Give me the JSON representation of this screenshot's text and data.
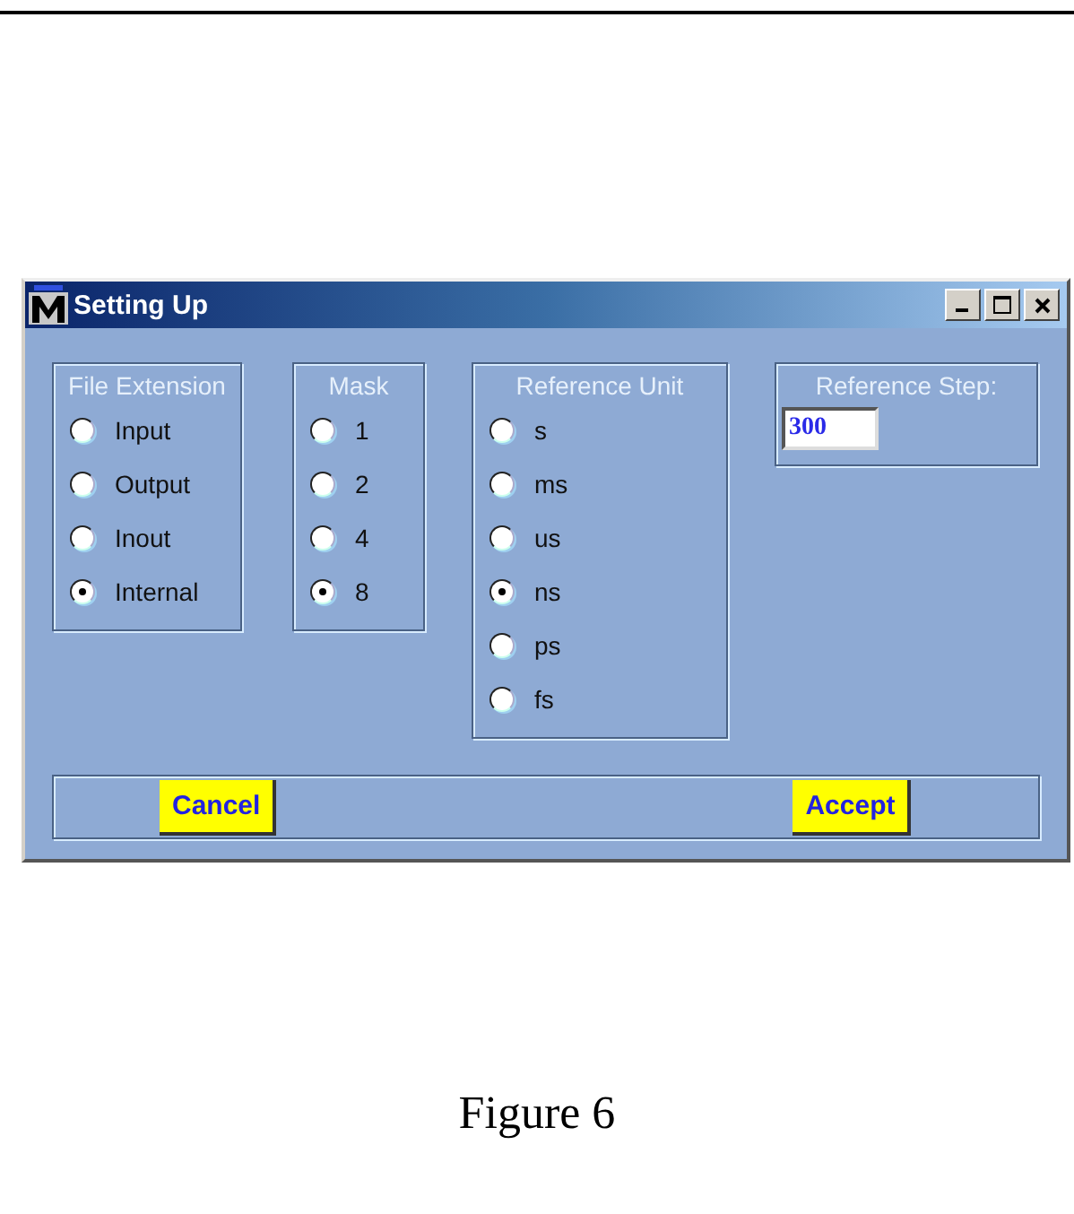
{
  "window": {
    "title": "Setting Up"
  },
  "groups": [
    {
      "kind": "radio",
      "title": "File Extension",
      "options": [
        {
          "label": "Input",
          "selected": false
        },
        {
          "label": "Output",
          "selected": false
        },
        {
          "label": "Inout",
          "selected": false
        },
        {
          "label": "Internal",
          "selected": true
        }
      ]
    },
    {
      "kind": "radio",
      "title": "Mask",
      "options": [
        {
          "label": "1",
          "selected": false
        },
        {
          "label": "2",
          "selected": false
        },
        {
          "label": "4",
          "selected": false
        },
        {
          "label": "8",
          "selected": true
        }
      ]
    },
    {
      "kind": "radio",
      "title": "Reference Unit",
      "options": [
        {
          "label": "s",
          "selected": false
        },
        {
          "label": "ms",
          "selected": false
        },
        {
          "label": "us",
          "selected": false
        },
        {
          "label": "ns",
          "selected": true
        },
        {
          "label": "ps",
          "selected": false
        },
        {
          "label": "fs",
          "selected": false
        }
      ]
    },
    {
      "kind": "field",
      "title": "Reference Step:",
      "value": "300"
    }
  ],
  "buttons": [
    "Cancel",
    "Accept"
  ],
  "caption": "Figure 6"
}
